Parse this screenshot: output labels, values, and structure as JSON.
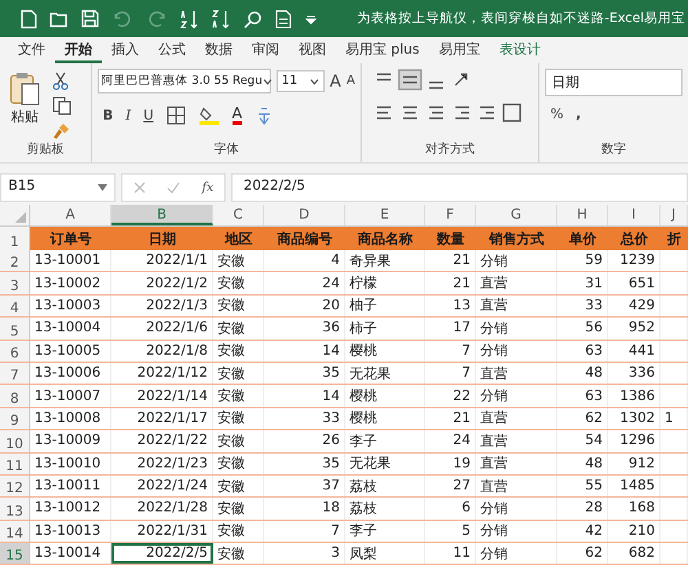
{
  "title_bar": {
    "title": "为表格按上导航仪，表间穿梭自如不迷路-Excel易用宝"
  },
  "ribbon_tabs": [
    {
      "label": "文件",
      "selected": false
    },
    {
      "label": "开始",
      "selected": true
    },
    {
      "label": "插入",
      "selected": false
    },
    {
      "label": "公式",
      "selected": false
    },
    {
      "label": "数据",
      "selected": false
    },
    {
      "label": "审阅",
      "selected": false
    },
    {
      "label": "视图",
      "selected": false
    },
    {
      "label": "易用宝 plus",
      "selected": false
    },
    {
      "label": "易用宝",
      "selected": false
    },
    {
      "label": "表设计",
      "selected": false
    }
  ],
  "ribbon": {
    "clipboard": {
      "paste_label": "粘贴",
      "label": "剪贴板"
    },
    "font": {
      "font_name": "阿里巴巴普惠体 3.0 55 Regu",
      "font_size": "11",
      "grow": "A",
      "shrink": "A",
      "style_buttons": [
        "B",
        "I",
        "U"
      ],
      "font_color": "A",
      "label": "字体"
    },
    "alignment": {
      "label": "对齐方式"
    },
    "number": {
      "format": "日期",
      "percent": "%",
      "comma": ",",
      "label": "数字"
    }
  },
  "formula_bar": {
    "name_box": "B15",
    "function_label": "fx",
    "formula": "2022/2/5"
  },
  "columns": [
    {
      "label": "A",
      "selected": false
    },
    {
      "label": "B",
      "selected": true
    },
    {
      "label": "C",
      "selected": false
    },
    {
      "label": "D",
      "selected": false
    },
    {
      "label": "E",
      "selected": false
    },
    {
      "label": "F",
      "selected": false
    },
    {
      "label": "G",
      "selected": false
    },
    {
      "label": "H",
      "selected": false
    },
    {
      "label": "I",
      "selected": false
    },
    {
      "label": "J",
      "selected": false
    }
  ],
  "rows": [
    {
      "number": "1",
      "selected": false,
      "kind": "header",
      "cells": [
        "订单号",
        "日期",
        "地区",
        "商品编号",
        "商品名称",
        "数量",
        "销售方式",
        "单价",
        "总价",
        "折"
      ]
    },
    {
      "number": "2",
      "selected": false,
      "kind": "data",
      "cells": [
        "13-10001",
        "2022/1/1",
        "安徽",
        "4",
        "奇异果",
        "21",
        "分销",
        "59",
        "1239"
      ]
    },
    {
      "number": "3",
      "selected": false,
      "kind": "data",
      "cells": [
        "13-10002",
        "2022/1/2",
        "安徽",
        "24",
        "柠檬",
        "21",
        "直营",
        "31",
        "651"
      ]
    },
    {
      "number": "4",
      "selected": false,
      "kind": "data",
      "cells": [
        "13-10003",
        "2022/1/3",
        "安徽",
        "20",
        "柚子",
        "13",
        "直营",
        "33",
        "429"
      ]
    },
    {
      "number": "5",
      "selected": false,
      "kind": "data",
      "cells": [
        "13-10004",
        "2022/1/6",
        "安徽",
        "36",
        "柿子",
        "17",
        "分销",
        "56",
        "952"
      ]
    },
    {
      "number": "6",
      "selected": false,
      "kind": "data",
      "cells": [
        "13-10005",
        "2022/1/8",
        "安徽",
        "14",
        "樱桃",
        "7",
        "分销",
        "63",
        "441"
      ]
    },
    {
      "number": "7",
      "selected": false,
      "kind": "data",
      "cells": [
        "13-10006",
        "2022/1/12",
        "安徽",
        "35",
        "无花果",
        "7",
        "直营",
        "48",
        "336"
      ]
    },
    {
      "number": "8",
      "selected": false,
      "kind": "data",
      "cells": [
        "13-10007",
        "2022/1/14",
        "安徽",
        "14",
        "樱桃",
        "22",
        "分销",
        "63",
        "1386"
      ]
    },
    {
      "number": "9",
      "selected": false,
      "kind": "data",
      "cells": [
        "13-10008",
        "2022/1/17",
        "安徽",
        "33",
        "樱桃",
        "21",
        "直营",
        "62",
        "1302",
        "1"
      ]
    },
    {
      "number": "10",
      "selected": false,
      "kind": "data",
      "cells": [
        "13-10009",
        "2022/1/22",
        "安徽",
        "26",
        "李子",
        "24",
        "直营",
        "54",
        "1296"
      ]
    },
    {
      "number": "11",
      "selected": false,
      "kind": "data",
      "cells": [
        "13-10010",
        "2022/1/23",
        "安徽",
        "35",
        "无花果",
        "19",
        "直营",
        "48",
        "912"
      ]
    },
    {
      "number": "12",
      "selected": false,
      "kind": "data",
      "cells": [
        "13-10011",
        "2022/1/24",
        "安徽",
        "37",
        "荔枝",
        "27",
        "直营",
        "55",
        "1485"
      ]
    },
    {
      "number": "13",
      "selected": false,
      "kind": "data",
      "cells": [
        "13-10012",
        "2022/1/28",
        "安徽",
        "18",
        "荔枝",
        "6",
        "分销",
        "28",
        "168"
      ]
    },
    {
      "number": "14",
      "selected": false,
      "kind": "data",
      "cells": [
        "13-10013",
        "2022/1/31",
        "安徽",
        "7",
        "李子",
        "5",
        "分销",
        "42",
        "210"
      ]
    },
    {
      "number": "15",
      "selected": true,
      "kind": "data",
      "cells": [
        "13-10014",
        "2022/2/5",
        "安徽",
        "3",
        "凤梨",
        "11",
        "分销",
        "62",
        "682"
      ]
    }
  ]
}
